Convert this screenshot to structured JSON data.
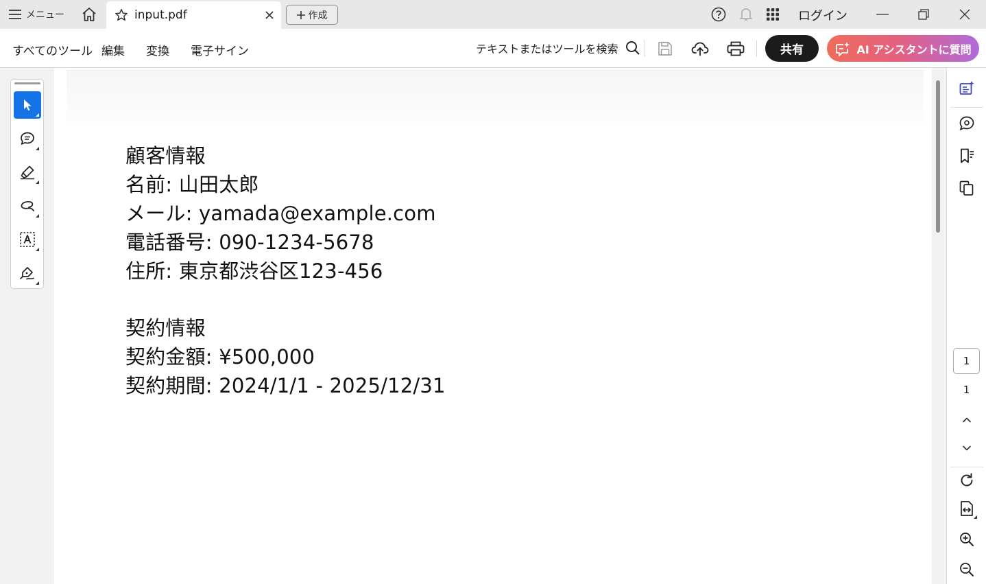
{
  "titlebar": {
    "menu_label": "メニュー",
    "tab_title": "input.pdf",
    "create_label": "作成",
    "login_label": "ログイン"
  },
  "toolbar": {
    "nav": [
      "すべてのツール",
      "編集",
      "変換",
      "電子サイン"
    ],
    "search_label": "テキストまたはツールを検索",
    "share_label": "共有",
    "ai_label": "AI アシスタントに質問"
  },
  "document": {
    "lines": [
      "顧客情報",
      "名前: 山田太郎",
      "メール: yamada@example.com",
      "電話番号: 090-1234-5678",
      "住所: 東京都渋谷区123-456",
      "契約情報",
      "契約金額: ¥500,000",
      "契約期間: 2024/1/1 - 2025/12/31"
    ]
  },
  "pagination": {
    "current_page": "1",
    "total_pages": "1"
  },
  "colors": {
    "active_tool": "#1473e6",
    "share_button": "#1b1b1b",
    "ai_gradient_start": "#ef6d5b",
    "ai_gradient_end": "#b06bdc"
  }
}
